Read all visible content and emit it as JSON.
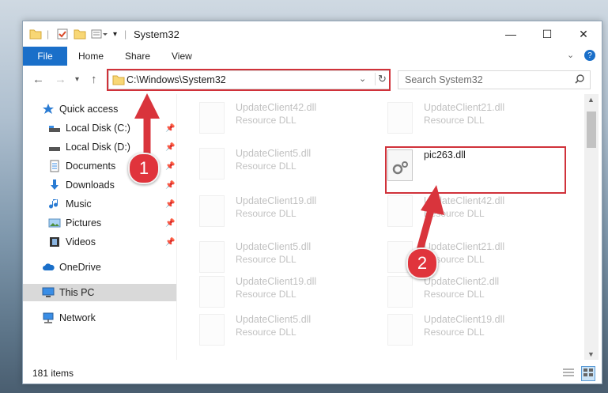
{
  "window": {
    "title": "System32"
  },
  "ribbon": {
    "tabs": [
      "File",
      "Home",
      "Share",
      "View"
    ]
  },
  "address_bar": {
    "path": "C:\\Windows\\System32"
  },
  "search": {
    "placeholder": "Search System32"
  },
  "sidebar": {
    "items": [
      {
        "label": "Quick access",
        "icon": "star-icon",
        "pinned": false
      },
      {
        "label": "Local Disk (C:)",
        "icon": "drive-icon",
        "pinned": true
      },
      {
        "label": "Local Disk (D:)",
        "icon": "drive-icon",
        "pinned": true
      },
      {
        "label": "Documents",
        "icon": "documents-icon",
        "pinned": true
      },
      {
        "label": "Downloads",
        "icon": "download-icon",
        "pinned": true
      },
      {
        "label": "Music",
        "icon": "music-icon",
        "pinned": true
      },
      {
        "label": "Pictures",
        "icon": "pictures-icon",
        "pinned": true
      },
      {
        "label": "Videos",
        "icon": "videos-icon",
        "pinned": true
      },
      {
        "label": "OneDrive",
        "icon": "cloud-icon",
        "pinned": false
      },
      {
        "label": "This PC",
        "icon": "computer-icon",
        "pinned": false,
        "selected": true
      },
      {
        "label": "Network",
        "icon": "network-icon",
        "pinned": false
      }
    ]
  },
  "files": [
    {
      "name": "UpdateClient42.dll",
      "type": "Resource DLL"
    },
    {
      "name": "UpdateClient21.dll",
      "type": "Resource DLL"
    },
    {
      "name": "UpdateClient5.dll",
      "type": "Resource DLL"
    },
    {
      "name": "pic263.dll",
      "type": ""
    },
    {
      "name": "UpdateClient19.dll",
      "type": "Resource DLL"
    },
    {
      "name": "UpdateClient42.dll",
      "type": "Resource DLL"
    },
    {
      "name": "UpdateClient5.dll",
      "type": "Resource DLL"
    },
    {
      "name": "UpdateClient21.dll",
      "type": "Resource DLL"
    },
    {
      "name": "UpdateClient19.dll",
      "type": "Resource DLL"
    },
    {
      "name": "UpdateClient2.dll",
      "type": "Resource DLL"
    },
    {
      "name": "UpdateClient5.dll",
      "type": "Resource DLL"
    },
    {
      "name": "UpdateClient19.dll",
      "type": "Resource DLL"
    }
  ],
  "status": {
    "item_count": "181 items"
  },
  "callouts": [
    "1",
    "2"
  ],
  "colors": {
    "accent": "#1a6fc9",
    "highlight": "#d0323a"
  }
}
